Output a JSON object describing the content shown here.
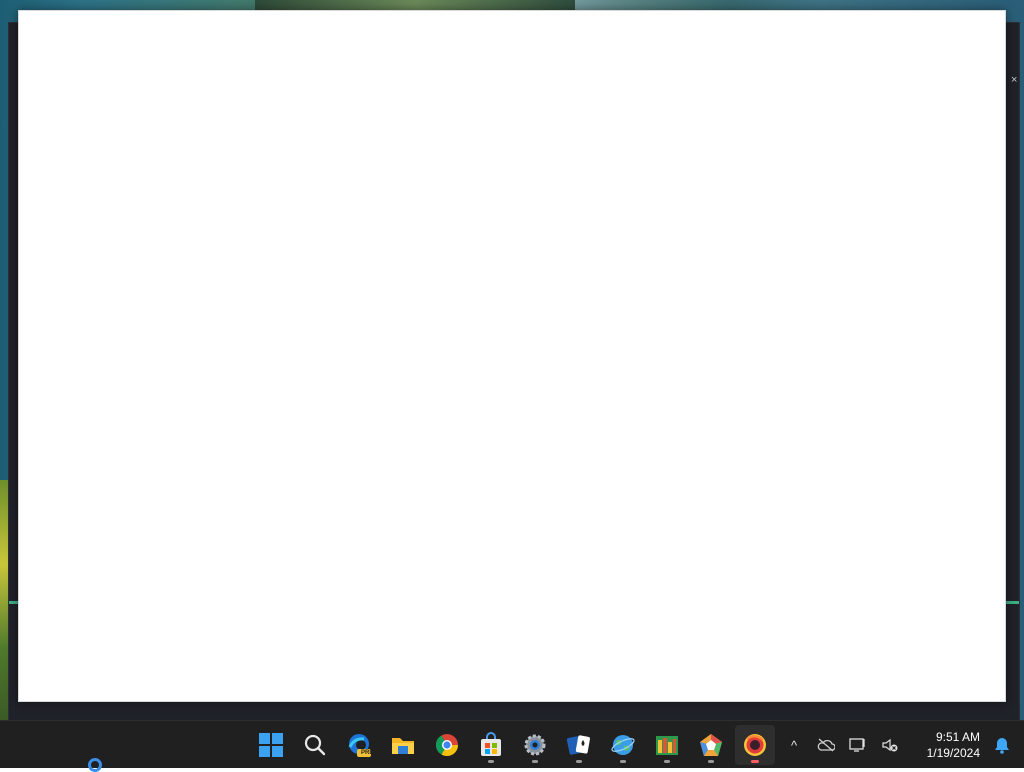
{
  "desktop": {
    "wallpaper": "coastal cliffs over ocean"
  },
  "windows": {
    "back_window": {
      "theme": "dark",
      "accent_color": "#3fae86",
      "close_glyph": "×"
    },
    "front_window": {
      "state": "blank",
      "background": "#ffffff"
    }
  },
  "taskbar": {
    "pinned": [
      {
        "name": "Start",
        "icon": "windows-logo-icon",
        "running": false,
        "active": false
      },
      {
        "name": "Search",
        "icon": "search-icon",
        "running": false,
        "active": false
      },
      {
        "name": "Microsoft Edge Preview",
        "icon": "edge-preview-icon",
        "badge": "PRE",
        "running": false,
        "active": false
      },
      {
        "name": "File Explorer",
        "icon": "folder-icon",
        "running": false,
        "active": false
      },
      {
        "name": "Google Chrome",
        "icon": "chrome-icon",
        "running": false,
        "active": false
      },
      {
        "name": "Microsoft Store",
        "icon": "store-icon",
        "running": true,
        "active": false
      },
      {
        "name": "Settings",
        "icon": "settings-gear-icon",
        "running": true,
        "active": false
      },
      {
        "name": "Solitaire",
        "icon": "solitaire-cards-icon",
        "running": true,
        "active": false
      },
      {
        "name": "Browser",
        "icon": "globe-icon",
        "running": true,
        "active": false
      },
      {
        "name": "Spreadsheet App",
        "icon": "colorful-tiles-icon",
        "running": true,
        "active": false
      },
      {
        "name": "Gem App",
        "icon": "gem-icon",
        "running": true,
        "active": false
      },
      {
        "name": "Firefox Nightly",
        "icon": "red-browser-icon",
        "running": true,
        "active": true
      }
    ],
    "tray": {
      "chevron": "^",
      "icons": [
        "onedrive-offline-icon",
        "network-icon",
        "volume-muted-icon"
      ],
      "time": "9:51 AM",
      "date": "1/19/2024",
      "notification_icon": "bell-icon"
    }
  }
}
